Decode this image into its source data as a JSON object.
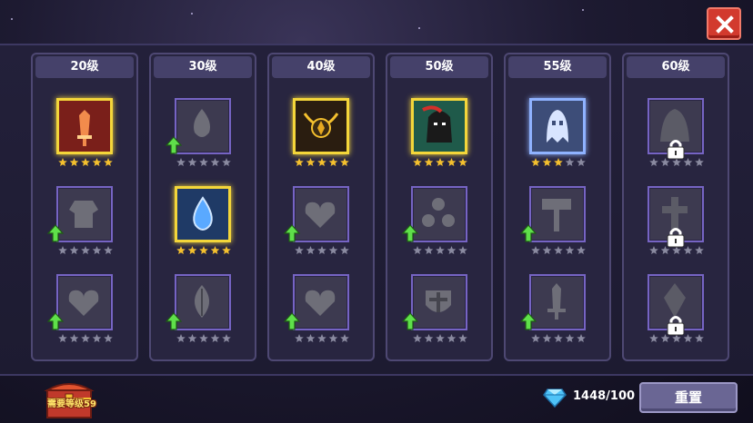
{
  "close_icon": "close-x-icon",
  "columns": [
    {
      "level": "20级",
      "slots": [
        {
          "icon": "sword-icon",
          "state": "unlocked",
          "frame": "gold",
          "stars": 5,
          "max_stars": 5,
          "upgradable": false
        },
        {
          "icon": "armor-icon",
          "state": "available",
          "stars": 0,
          "max_stars": 5,
          "upgradable": true
        },
        {
          "icon": "heart-icon",
          "state": "available",
          "stars": 0,
          "max_stars": 5,
          "upgradable": true
        }
      ]
    },
    {
      "level": "30级",
      "slots": [
        {
          "icon": "flame-icon",
          "state": "available",
          "stars": 0,
          "max_stars": 5,
          "upgradable": true
        },
        {
          "icon": "water-drop-icon",
          "state": "unlocked",
          "frame": "gold",
          "stars": 5,
          "max_stars": 5,
          "upgradable": false
        },
        {
          "icon": "leaf-icon",
          "state": "available",
          "stars": 0,
          "max_stars": 5,
          "upgradable": true
        }
      ]
    },
    {
      "level": "40级",
      "slots": [
        {
          "icon": "golden-relic-icon",
          "state": "unlocked",
          "frame": "gold",
          "stars": 5,
          "max_stars": 5,
          "upgradable": false
        },
        {
          "icon": "heart-icon",
          "state": "available",
          "stars": 0,
          "max_stars": 5,
          "upgradable": true
        },
        {
          "icon": "heart-icon",
          "state": "available",
          "stars": 0,
          "max_stars": 5,
          "upgradable": true
        }
      ]
    },
    {
      "level": "50级",
      "slots": [
        {
          "icon": "hooded-figure-icon",
          "state": "unlocked",
          "frame": "gold",
          "stars": 5,
          "max_stars": 5,
          "upgradable": false
        },
        {
          "icon": "triple-orb-icon",
          "state": "available",
          "stars": 0,
          "max_stars": 5,
          "upgradable": true
        },
        {
          "icon": "shield-cross-icon",
          "state": "available",
          "stars": 0,
          "max_stars": 5,
          "upgradable": true
        }
      ]
    },
    {
      "level": "55级",
      "slots": [
        {
          "icon": "ghost-icon",
          "state": "unlocked",
          "frame": "blue",
          "stars": 3,
          "max_stars": 5,
          "upgradable": false
        },
        {
          "icon": "hammer-icon",
          "state": "available",
          "stars": 0,
          "max_stars": 5,
          "upgradable": true
        },
        {
          "icon": "dagger-icon",
          "state": "available",
          "stars": 0,
          "max_stars": 5,
          "upgradable": true
        }
      ]
    },
    {
      "level": "60级",
      "slots": [
        {
          "icon": "cloak-icon",
          "state": "locked",
          "stars": 0,
          "max_stars": 5,
          "upgradable": false
        },
        {
          "icon": "cross-icon",
          "state": "locked",
          "stars": 0,
          "max_stars": 5,
          "upgradable": false
        },
        {
          "icon": "crystal-icon",
          "state": "locked",
          "stars": 0,
          "max_stars": 5,
          "upgradable": false
        }
      ]
    }
  ],
  "footer": {
    "chest_label": "需要等级59",
    "gem_count": "1448/100",
    "reset_label": "重置"
  },
  "colors": {
    "gold_frame": "#f4d63a",
    "blue_frame": "#8fb2ff",
    "star_filled": "#f4c02e",
    "star_empty": "#8a8aa0",
    "upgrade_arrow": "#5fe04a",
    "close_button": "#d23a2e",
    "reset_button": "#6a6694"
  }
}
